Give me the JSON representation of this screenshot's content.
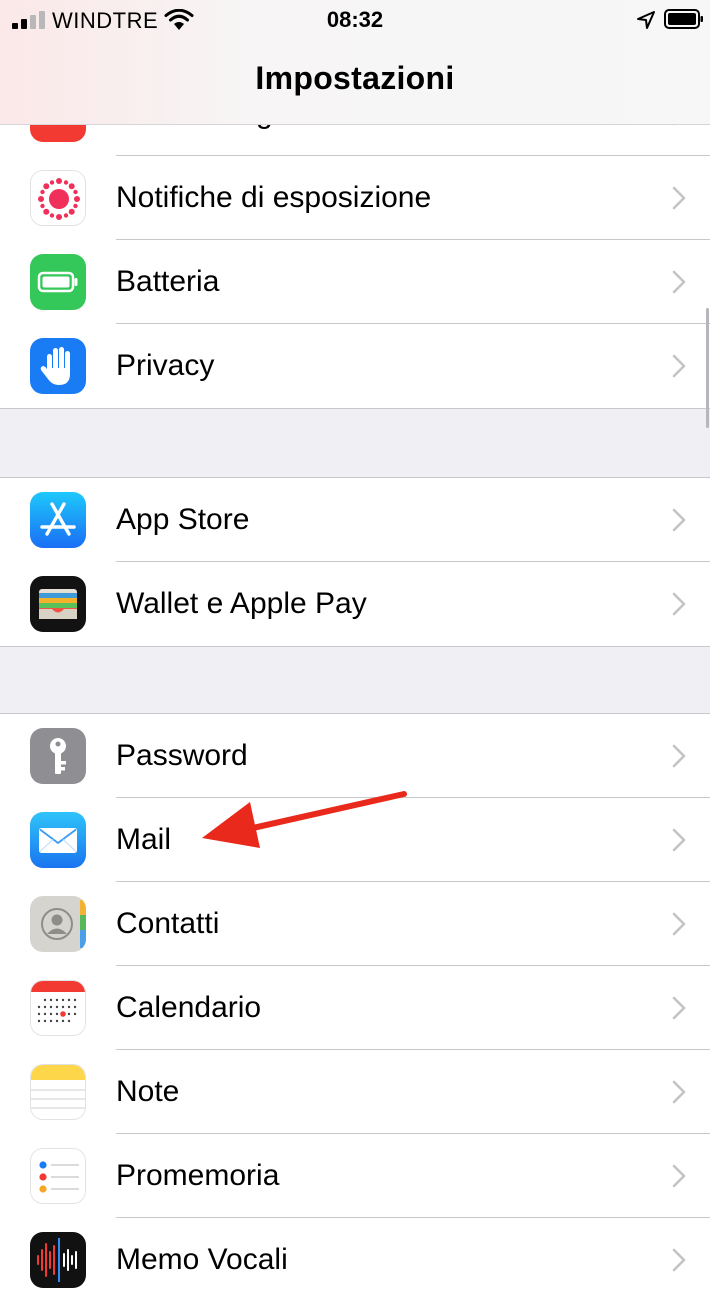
{
  "status_bar": {
    "carrier": "WINDTRE",
    "time": "08:32",
    "icons": [
      "signal-icon",
      "wifi-icon",
      "location-arrow-icon",
      "battery-icon"
    ]
  },
  "nav": {
    "title": "Impostazioni"
  },
  "groups": [
    {
      "items": [
        {
          "label": "SOS emergenze",
          "icon": "sos-icon"
        },
        {
          "label": "Notifiche di esposizione",
          "icon": "exposure-notification-icon"
        },
        {
          "label": "Batteria",
          "icon": "battery-settings-icon"
        },
        {
          "label": "Privacy",
          "icon": "privacy-hand-icon"
        }
      ]
    },
    {
      "items": [
        {
          "label": "App Store",
          "icon": "app-store-icon"
        },
        {
          "label": "Wallet e Apple Pay",
          "icon": "wallet-icon"
        }
      ]
    },
    {
      "items": [
        {
          "label": "Password",
          "icon": "key-icon"
        },
        {
          "label": "Mail",
          "icon": "mail-icon"
        },
        {
          "label": "Contatti",
          "icon": "contacts-icon"
        },
        {
          "label": "Calendario",
          "icon": "calendar-icon"
        },
        {
          "label": "Note",
          "icon": "notes-icon"
        },
        {
          "label": "Promemoria",
          "icon": "reminders-icon"
        },
        {
          "label": "Memo Vocali",
          "icon": "voice-memos-icon"
        }
      ]
    }
  ],
  "annotation": {
    "icon": "red-arrow-icon",
    "color": "#e8291c"
  },
  "colors": {
    "accent_green": "#34c759",
    "accent_blue": "#1a7cf4",
    "accent_red": "#f23a33",
    "separator": "#c8c7cc",
    "chevron": "#c4c4c7"
  }
}
